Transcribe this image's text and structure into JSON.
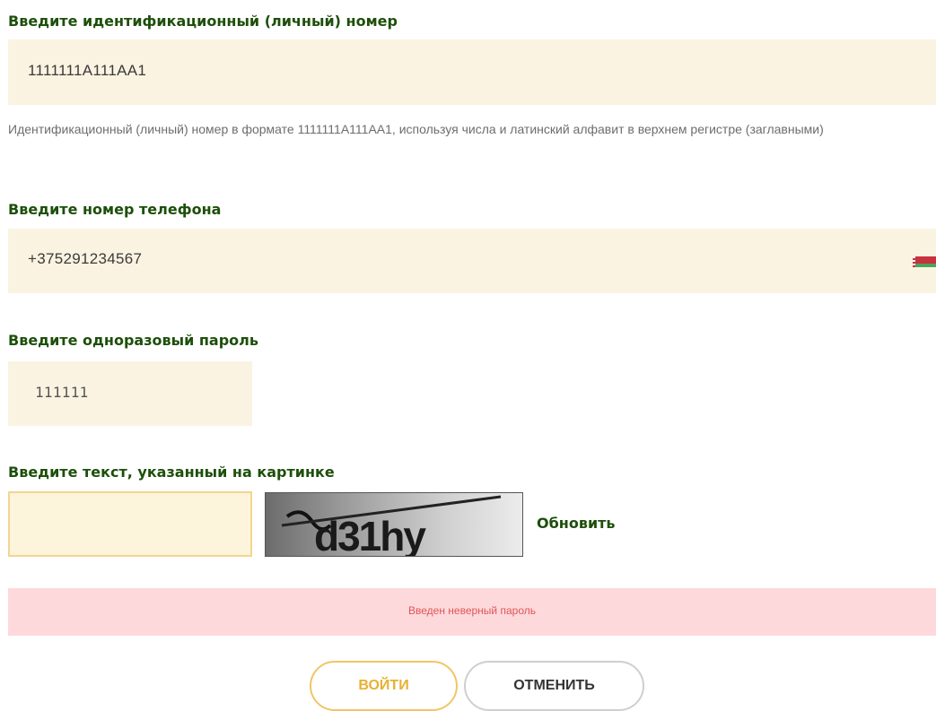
{
  "id_section": {
    "label": "Введите идентификационный (личный) номер",
    "value": "1111111A111AA1",
    "hint": "Идентификационный (личный) номер в формате 1111111A111AA1, используя числа и латинский алфавит в верхнем регистре (заглавными)"
  },
  "phone_section": {
    "label": "Введите номер телефона",
    "value": "+375291234567",
    "flag_icon": "belarus-flag-icon"
  },
  "otp_section": {
    "label": "Введите одноразовый пароль",
    "value": "111111"
  },
  "captcha_section": {
    "label": "Введите текст, указанный на картинке",
    "input_value": "",
    "captcha_text": "d31hy",
    "refresh_label": "Обновить"
  },
  "error": {
    "message": "Введен неверный пароль"
  },
  "buttons": {
    "login_label": "ВОЙТИ",
    "cancel_label": "ОТМЕНИТЬ"
  },
  "colors": {
    "label_green": "#1d4f0a",
    "field_background": "#fbf3e1",
    "error_background": "#fdd9dc",
    "error_text": "#e05555",
    "accent_yellow": "#f1c567"
  }
}
